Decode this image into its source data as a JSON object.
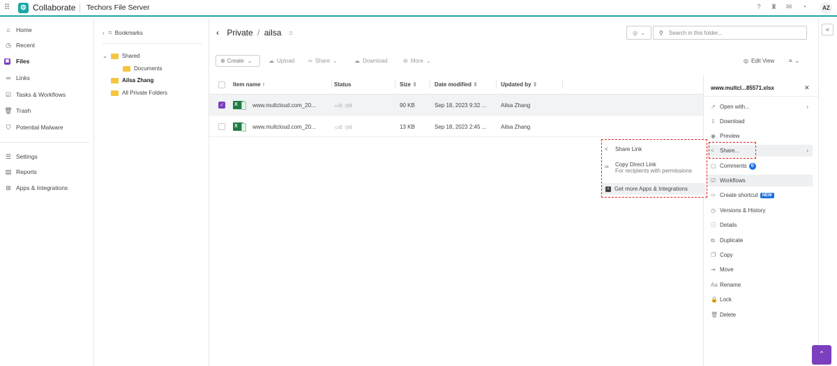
{
  "app": {
    "name": "Collaborate",
    "server": "Techors File Server",
    "user_initials": "AZ"
  },
  "nav": {
    "items": [
      {
        "label": "Home",
        "icon": "⌂"
      },
      {
        "label": "Recent",
        "icon": "◷"
      },
      {
        "label": "Files",
        "icon": "▣"
      },
      {
        "label": "Links",
        "icon": "∞"
      },
      {
        "label": "Tasks & Workflows",
        "icon": "☑"
      },
      {
        "label": "Trash",
        "icon": "🗑"
      },
      {
        "label": "Potential Malware",
        "icon": "⛉"
      }
    ],
    "bottom_items": [
      {
        "label": "Settings",
        "icon": "☰"
      },
      {
        "label": "Reports",
        "icon": "▤"
      },
      {
        "label": "Apps & Integrations",
        "icon": "⊞"
      }
    ]
  },
  "tree": {
    "bookmarks": "Bookmarks",
    "shared": "Shared",
    "documents": "Documents",
    "user_folder": "Ailsa Zhang",
    "all_private": "All Private Folders"
  },
  "main": {
    "breadcrumb_root": "Private",
    "breadcrumb_sep": "/",
    "breadcrumb_current": "ailsa",
    "search_placeholder": "Search in this folder...",
    "toolbar": {
      "create": "Create",
      "upload": "Upload",
      "share": "Share",
      "download": "Download",
      "more": "More",
      "edit_view": "Edit View"
    },
    "columns": [
      "Item name",
      "Status",
      "Size",
      "Date modified",
      "Updated by"
    ],
    "rows": [
      {
        "name": "www.multcloud.com_20...",
        "comments": "0",
        "versions": "0",
        "size": "90 KB",
        "date": "Sep 18, 2023 9:32 ...",
        "by": "Ailsa Zhang",
        "selected": true
      },
      {
        "name": "www.multcloud.com_20...",
        "comments": "0",
        "versions": "0",
        "size": "13 KB",
        "date": "Sep 18, 2023 2:45 ...",
        "by": "Ailsa Zhang",
        "selected": false
      }
    ]
  },
  "panel": {
    "title": "www.multcl...85571.xlsx",
    "items": [
      {
        "label": "Open with...",
        "icon": "↗"
      },
      {
        "label": "Download",
        "icon": "⇩"
      },
      {
        "label": "Preview",
        "icon": "◉"
      },
      {
        "label": "Share...",
        "icon": "<"
      },
      {
        "label": "Comments",
        "icon": "▢"
      },
      {
        "label": "Workflows",
        "icon": "☑"
      },
      {
        "label": "Create shortcut",
        "icon": "⇨"
      },
      {
        "label": "Versions & History",
        "icon": "◷"
      },
      {
        "label": "Details",
        "icon": "ⓘ"
      },
      {
        "label": "Duplicate",
        "icon": "⧉"
      },
      {
        "label": "Copy",
        "icon": "❐"
      },
      {
        "label": "Move",
        "icon": "⇥"
      },
      {
        "label": "Rename",
        "icon": "Aa"
      },
      {
        "label": "Lock",
        "icon": "🔒"
      },
      {
        "label": "Delete",
        "icon": "🗑"
      }
    ],
    "comments_count": "0",
    "new_badge": "NEW"
  },
  "share_submenu": {
    "share_link": "Share Link",
    "copy_direct": "Copy Direct Link",
    "copy_direct_sub": "For recipients with permissions",
    "get_more": "Get more Apps & Integrations"
  },
  "colors": {
    "accent": "#1aa8a8",
    "purple": "#7b3fbf",
    "highlight": "#d9201d",
    "badge": "#1b6fe0"
  }
}
